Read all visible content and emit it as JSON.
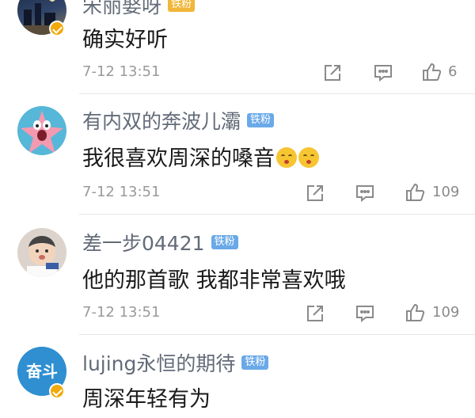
{
  "comments": [
    {
      "username": "宋丽娶呀",
      "badge": "铁粉",
      "text": "确实好听",
      "time": "7-12 13:51",
      "likes": "6",
      "avatar_icon": "night-scene-avatar"
    },
    {
      "username": "有内双的奔波儿灞",
      "badge": "铁粉",
      "text": "我很喜欢周深的嗓音",
      "emojis": [
        "kiss-emoji",
        "kiss-emoji"
      ],
      "time": "7-12 13:51",
      "likes": "109",
      "avatar_icon": "patrick-star-avatar"
    },
    {
      "username": "差一步04421",
      "badge": "铁粉",
      "text": "他的那首歌 我都非常喜欢哦",
      "time": "7-12 13:51",
      "likes": "109",
      "avatar_icon": "baby-avatar"
    },
    {
      "username": "lujing永恒的期待",
      "badge": "铁粉",
      "text": "周深年轻有为",
      "avatar_text": "奋斗",
      "avatar_icon": "fendou-avatar"
    }
  ],
  "colors": {
    "username": "#636b78",
    "badge_blue": "#6aa9e8",
    "badge_gold": "#f0b63a",
    "divider": "#e6e6e6",
    "verified": "#f2a90b"
  },
  "icons": [
    "share-icon",
    "comment-icon",
    "like-icon"
  ]
}
